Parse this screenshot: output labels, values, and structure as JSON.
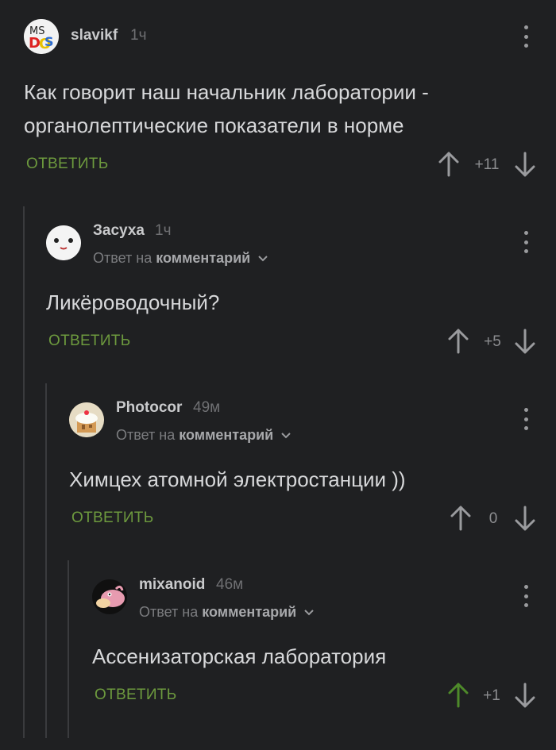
{
  "colors": {
    "background": "#1f2022",
    "reply_green": "#6d9a3e",
    "upvoted_green": "#4e8a2a",
    "muted": "#8c8d90"
  },
  "comments": [
    {
      "username": "slavikf",
      "time": "1ч",
      "reply_prefix": "",
      "reply_target": "",
      "text_lines": [
        "Как говорит наш начальник лаборатории -",
        "органолептические показатели в норме"
      ],
      "reply_label": "ОТВЕТИТЬ",
      "rating": "+11",
      "avatar_icon": "msdos-logo-icon",
      "upvoted": false
    },
    {
      "username": "Засуха",
      "time": "1ч",
      "reply_prefix": "Ответ на",
      "reply_target": "комментарий",
      "text_lines": [
        "Ликёроводочный?"
      ],
      "reply_label": "ОТВЕТИТЬ",
      "rating": "+5",
      "avatar_icon": "white-blob-face-icon",
      "upvoted": false
    },
    {
      "username": "Photocor",
      "time": "49м",
      "reply_prefix": "Ответ на",
      "reply_target": "комментарий",
      "text_lines": [
        "Химцех атомной электростанции ))"
      ],
      "reply_label": "ОТВЕТИТЬ",
      "rating": "0",
      "avatar_icon": "cake-house-icon",
      "upvoted": false
    },
    {
      "username": "mixanoid",
      "time": "46м",
      "reply_prefix": "Ответ на",
      "reply_target": "комментарий",
      "text_lines": [
        "Ассенизаторская лаборатория"
      ],
      "reply_label": "ОТВЕТИТЬ",
      "rating": "+1",
      "avatar_icon": "slowpoke-icon",
      "upvoted": true
    }
  ]
}
